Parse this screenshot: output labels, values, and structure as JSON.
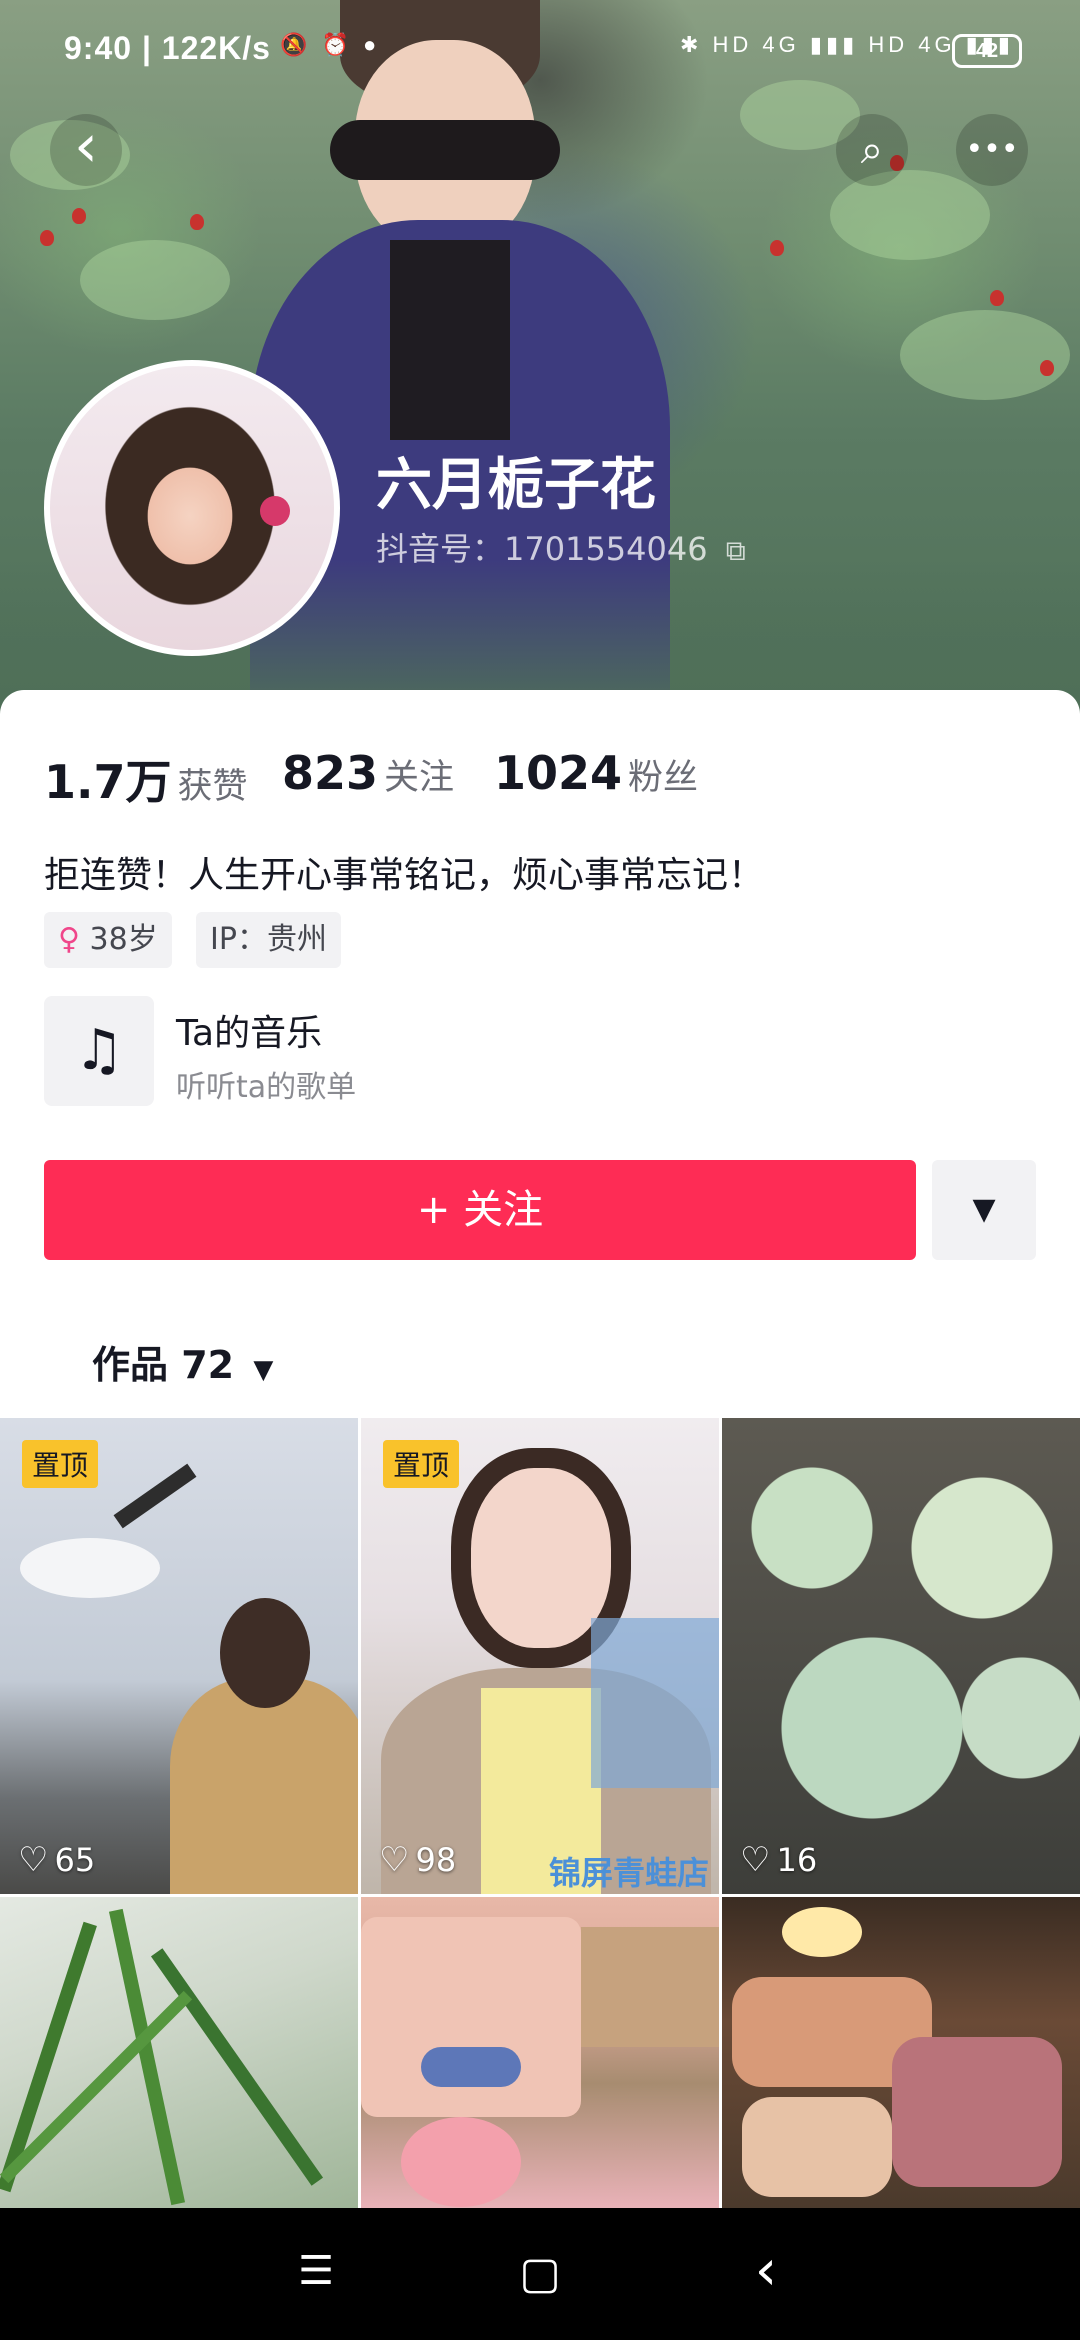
{
  "status_bar": {
    "time": "9:40 | 122K/s",
    "left_icons": "🔕 ⏰ ●",
    "right_icons": "✱ HD 4G ▮▮▮ HD 4G ▮▮▮",
    "battery": "42"
  },
  "nav": {
    "back_icon": "‹",
    "search_icon": "⌕",
    "more_icon": "•••"
  },
  "profile": {
    "name": "六月栀子花",
    "douyin_id": "抖音号：1701554046",
    "copy_icon": "⧉"
  },
  "stats": [
    {
      "num": "1.7万",
      "label": "获赞"
    },
    {
      "num": "823",
      "label": "关注"
    },
    {
      "num": "1024",
      "label": "粉丝"
    }
  ],
  "bio": "拒连赞！人生开心事常铭记，烦心事常忘记！",
  "tags": {
    "age_icon": "♀",
    "age": "38岁",
    "ip": "IP：贵州"
  },
  "music": {
    "title": "Ta的音乐",
    "subtitle": "听听ta的歌单",
    "icon": "♫"
  },
  "actions": {
    "follow": "+ 关注",
    "more_icon": "▼"
  },
  "works_tab": {
    "label": "作品 72",
    "caret": "▼"
  },
  "grid": [
    {
      "pinned": "置顶",
      "likes": "65"
    },
    {
      "pinned": "置顶",
      "likes": "98",
      "watermark": "锦屏青蛙店"
    },
    {
      "pinned": "",
      "likes": "16"
    },
    {
      "pinned": "",
      "likes": ""
    },
    {
      "pinned": "",
      "likes": ""
    },
    {
      "pinned": "",
      "likes": ""
    }
  ],
  "system_nav": {
    "menu": "☰",
    "home": "▢",
    "back": "‹"
  },
  "colors": {
    "accent": "#fe2c55",
    "pin": "#f9c22b"
  }
}
